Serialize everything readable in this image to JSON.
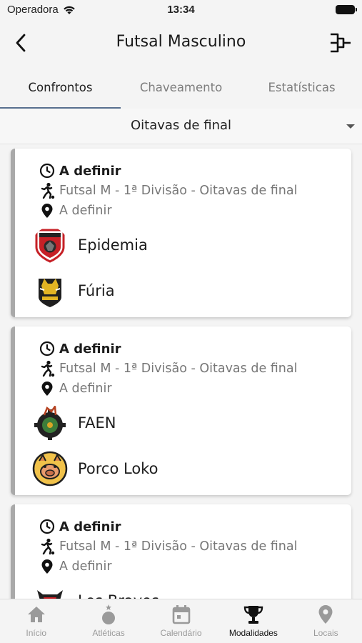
{
  "status": {
    "carrier": "Operadora",
    "time": "13:34"
  },
  "nav": {
    "title": "Futsal Masculino"
  },
  "tabs": [
    {
      "label": "Confrontos",
      "active": true
    },
    {
      "label": "Chaveamento",
      "active": false
    },
    {
      "label": "Estatísticas",
      "active": false
    }
  ],
  "phase": {
    "selected": "Oitavas de final"
  },
  "matches": [
    {
      "when": "A definir",
      "category": "Futsal M - 1ª Divisão - Oitavas de final",
      "place": "A definir",
      "teams": [
        {
          "name": "Epidemia",
          "logo": "shield-crest-red"
        },
        {
          "name": "Fúria",
          "logo": "boar-crest-yellow"
        }
      ]
    },
    {
      "when": "A definir",
      "category": "Futsal M - 1ª Divisão - Oitavas de final",
      "place": "A definir",
      "teams": [
        {
          "name": "FAEN",
          "logo": "gear-crest-green"
        },
        {
          "name": "Porco Loko",
          "logo": "pig-crest-orange"
        }
      ]
    },
    {
      "when": "A definir",
      "category": "Futsal M - 1ª Divisão - Oitavas de final",
      "place": "A definir",
      "teams": [
        {
          "name": "Los Bravos",
          "logo": "bull-crest-red"
        }
      ]
    }
  ],
  "tabbar": [
    {
      "label": "Início",
      "icon": "home-icon",
      "active": false
    },
    {
      "label": "Atléticas",
      "icon": "medal-icon",
      "active": false
    },
    {
      "label": "Calendário",
      "icon": "calendar-icon",
      "active": false
    },
    {
      "label": "Modalidades",
      "icon": "trophy-icon",
      "active": true
    },
    {
      "label": "Locais",
      "icon": "location-pin-icon",
      "active": false
    }
  ],
  "colors": {
    "tab_indicator": "#58708f",
    "card_stripe": "#a9a9a9"
  }
}
